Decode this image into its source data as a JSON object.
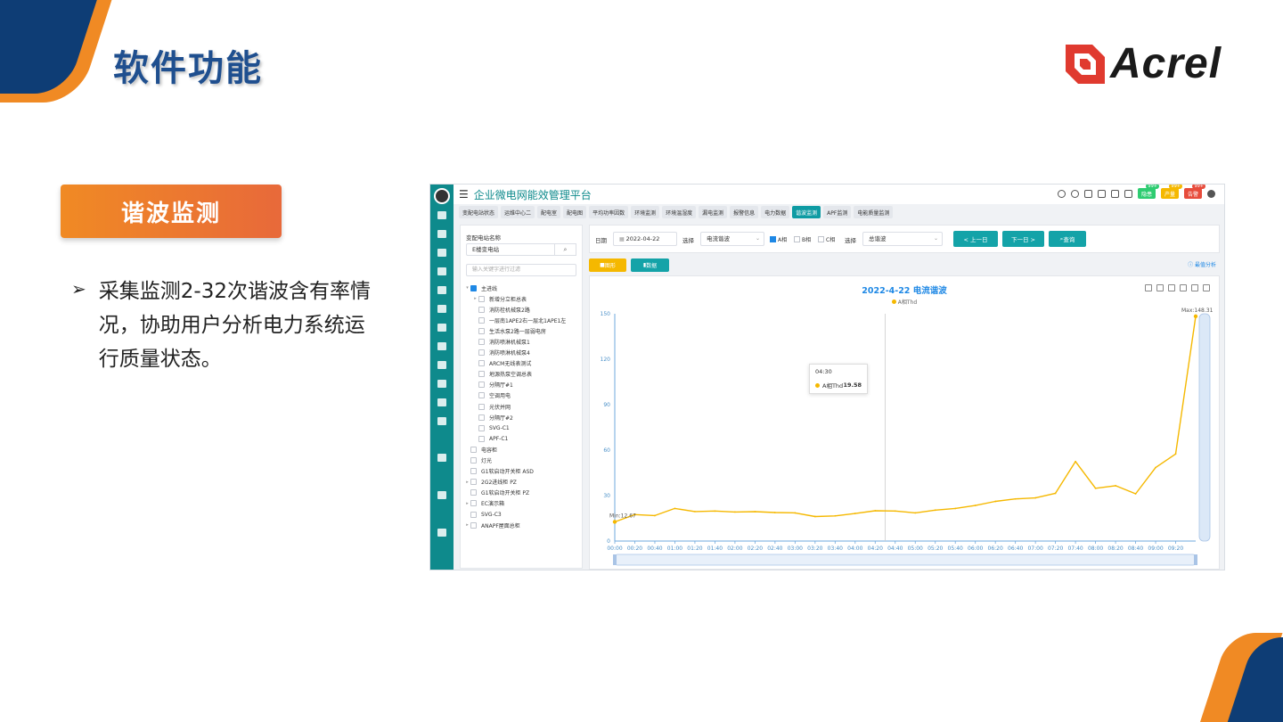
{
  "slide": {
    "title": "软件功能",
    "logo_text": "Acrel",
    "feature_label": "谐波监测",
    "bullet_text": "采集监测2-32次谐波含有率情况，协助用户分析电力系统运行质量状态。",
    "accent_orange": "#f08a24",
    "accent_navy": "#0e3d75"
  },
  "app": {
    "title": "企业微电网能效管理平台",
    "header_badges": [
      {
        "label": "隐患",
        "count": "99+",
        "color": "#2ecc71"
      },
      {
        "label": "产量",
        "count": "99+",
        "color": "#f5b800"
      },
      {
        "label": "告警",
        "count": "99+",
        "color": "#e74c3c"
      }
    ],
    "tabs": [
      "变配电站状态",
      "运维中心二",
      "配电室",
      "配电图",
      "平均功率因数",
      "环境监测",
      "环境温湿度",
      "漏电监测",
      "报警信息",
      "电力数据",
      "谐波监测",
      "APF监测",
      "电能质量监测"
    ],
    "active_tab_index": 10,
    "tree": {
      "station_label": "变配电站名称",
      "station_value": "E楼变电站",
      "filter_placeholder": "输入关键字进行过滤",
      "items": [
        {
          "label": "主进线",
          "level": 0,
          "caret": "▾",
          "checked": true
        },
        {
          "label": "新增分立柜总表",
          "level": 1,
          "caret": "▸",
          "checked": false
        },
        {
          "label": "消防栓机械泵2路",
          "level": 1,
          "caret": "",
          "checked": false
        },
        {
          "label": "一层南1APE2右一层北1APE1左",
          "level": 1,
          "caret": "",
          "checked": false
        },
        {
          "label": "生活水泵2路一层弱电房",
          "level": 1,
          "caret": "",
          "checked": false
        },
        {
          "label": "消防喷淋机械泵1",
          "level": 1,
          "caret": "",
          "checked": false
        },
        {
          "label": "消防喷淋机械泵4",
          "level": 1,
          "caret": "",
          "checked": false
        },
        {
          "label": "ARCM无线表测试",
          "level": 1,
          "caret": "",
          "checked": false
        },
        {
          "label": "地源热泵空调总表",
          "level": 1,
          "caret": "",
          "checked": false
        },
        {
          "label": "分隔厅#1",
          "level": 1,
          "caret": "",
          "checked": false
        },
        {
          "label": "空调用电",
          "level": 1,
          "caret": "",
          "checked": false
        },
        {
          "label": "光伏并网",
          "level": 1,
          "caret": "",
          "checked": false
        },
        {
          "label": "分隔厅#2",
          "level": 1,
          "caret": "",
          "checked": false
        },
        {
          "label": "SVG-C1",
          "level": 1,
          "caret": "",
          "checked": false
        },
        {
          "label": "APF-C1",
          "level": 1,
          "caret": "",
          "checked": false
        },
        {
          "label": "电容柜",
          "level": 0,
          "caret": "",
          "checked": false
        },
        {
          "label": "灯光",
          "level": 0,
          "caret": "",
          "checked": false
        },
        {
          "label": "G1软启动开关柜 ASD",
          "level": 0,
          "caret": "",
          "checked": false
        },
        {
          "label": "2G2进线柜 PZ",
          "level": 0,
          "caret": "▸",
          "checked": false
        },
        {
          "label": "G1软启动开关柜 PZ",
          "level": 0,
          "caret": "",
          "checked": false
        },
        {
          "label": "EC演示箱",
          "level": 0,
          "caret": "▸",
          "checked": false
        },
        {
          "label": "SVG-C3",
          "level": 0,
          "caret": "",
          "checked": false
        },
        {
          "label": "ANAPF屋面总柜",
          "level": 0,
          "caret": "▸",
          "checked": false
        }
      ]
    },
    "query": {
      "date_label": "日期",
      "date_value": "2022-04-22",
      "select_label_1": "选择",
      "select_value_1": "电流谐波",
      "phase_a": "A相",
      "phase_b": "B相",
      "phase_c": "C相",
      "select_label_2": "选择",
      "select_value_2": "总谐波",
      "prev_label": "< 上一日",
      "next_label": "下一日 >",
      "query_label": "查询"
    },
    "modes": {
      "chart_label": "图形",
      "data_label": "数据",
      "max_analysis": "最值分析"
    },
    "tooltip": {
      "time": "04:30",
      "series": "A相Thd",
      "value": "19.58"
    }
  },
  "chart_data": {
    "type": "line",
    "title": "2022-4-22  电流谐波",
    "xlabel": "",
    "ylabel": "",
    "ylim": [
      0,
      150
    ],
    "yticks": [
      0,
      30,
      60,
      90,
      120,
      150
    ],
    "x": [
      "00:00",
      "00:20",
      "00:40",
      "01:00",
      "01:20",
      "01:40",
      "02:00",
      "02:20",
      "02:40",
      "03:00",
      "03:20",
      "03:40",
      "04:00",
      "04:20",
      "04:40",
      "05:00",
      "05:20",
      "05:40",
      "06:00",
      "06:20",
      "06:40",
      "07:00",
      "07:20",
      "07:40",
      "08:00",
      "08:20",
      "08:40",
      "09:00",
      "09:20",
      "09:30"
    ],
    "series": [
      {
        "name": "A相Thd",
        "color": "#f5b800",
        "values": [
          12.67,
          17.5,
          16.8,
          21.5,
          19.5,
          19.8,
          19.2,
          19.4,
          18.8,
          18.6,
          16.2,
          16.6,
          18.2,
          20.0,
          19.8,
          18.6,
          20.4,
          21.5,
          23.5,
          26.2,
          27.8,
          28.5,
          31.5,
          52.5,
          34.8,
          36.5,
          31.2,
          48.5,
          57.5,
          148.31
        ]
      }
    ],
    "annotations": {
      "min_label": "Min:12.67",
      "max_label": "Max:148.31"
    },
    "grid": false,
    "legend": "top-center"
  }
}
